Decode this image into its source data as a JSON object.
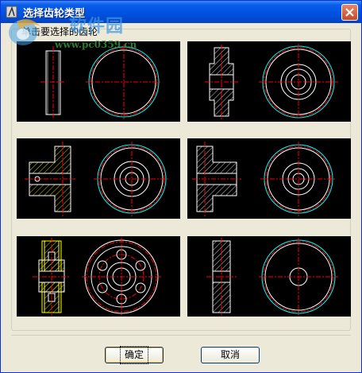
{
  "window": {
    "title": "选择齿轮类型",
    "instruction": "单击要选择的齿轮"
  },
  "watermark": {
    "text": "软件园",
    "url": "www.pc0359.cn"
  },
  "gears": [
    {
      "label": "gear-type-1"
    },
    {
      "label": "gear-type-2"
    },
    {
      "label": "gear-type-3"
    },
    {
      "label": "gear-type-4"
    },
    {
      "label": "gear-type-5"
    },
    {
      "label": "gear-type-6"
    }
  ],
  "buttons": {
    "ok": "确定",
    "cancel": "取消"
  },
  "colors": {
    "title_bar": "#0054e3",
    "dialog_bg": "#ece9d8",
    "drawing_bg": "#000000",
    "line_white": "#ffffff",
    "line_red": "#ff0000",
    "line_cyan": "#00ffff",
    "hatch_yellow": "#ffff00"
  }
}
